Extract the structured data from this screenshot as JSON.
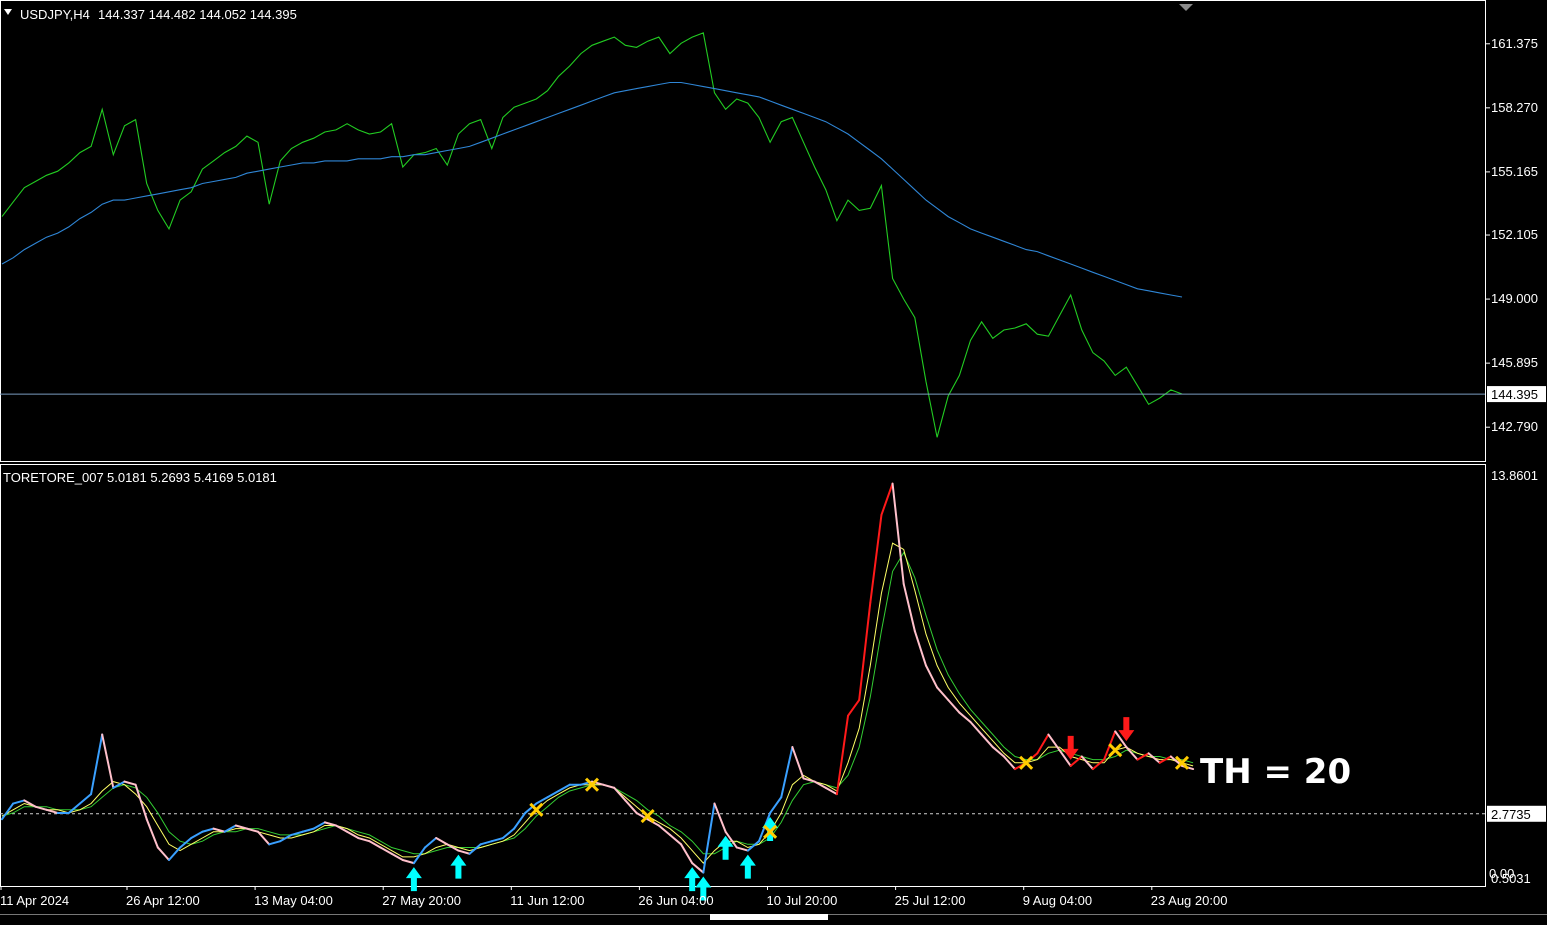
{
  "colors": {
    "background": "#000000",
    "price": "#22cc22",
    "ma": "#2f86d6",
    "rising": "#3aa0ff",
    "falling": "#ff1a1a",
    "neutral": "#ffc0cb",
    "signal_up": "#00ffff",
    "signal_down": "#ff1a1a",
    "cross": "#ffcc00",
    "fast_ma": "#ffff66",
    "slow_ma": "#33cc33",
    "level": "#cfcfcf"
  },
  "chart_data": [
    {
      "type": "line",
      "title": "USDJPY,H4",
      "ohlc": [
        "144.337",
        "144.482",
        "144.052",
        "144.395"
      ],
      "ylim": [
        141.2,
        163.4
      ],
      "y_ticks": [
        "161.375",
        "158.270",
        "155.165",
        "152.105",
        "149.000",
        "145.895",
        "142.790"
      ],
      "current_price": "144.395",
      "series": [
        {
          "name": "",
          "role": "price",
          "color_key": "price",
          "values": [
            153.0,
            153.7,
            154.4,
            154.7,
            155.0,
            155.2,
            155.6,
            156.1,
            156.4,
            158.2,
            156.0,
            157.4,
            157.7,
            154.6,
            153.3,
            152.4,
            153.8,
            154.2,
            155.3,
            155.7,
            156.1,
            156.4,
            156.9,
            156.6,
            153.6,
            155.7,
            156.3,
            156.6,
            156.8,
            157.1,
            157.2,
            157.5,
            157.2,
            157.0,
            157.1,
            157.5,
            155.4,
            156.0,
            156.1,
            156.3,
            155.5,
            157.0,
            157.5,
            157.7,
            156.3,
            157.8,
            158.3,
            158.5,
            158.7,
            159.1,
            159.8,
            160.3,
            160.9,
            161.3,
            161.5,
            161.7,
            161.3,
            161.2,
            161.5,
            161.7,
            160.9,
            161.4,
            161.7,
            161.9,
            159.0,
            158.2,
            158.7,
            158.5,
            157.8,
            156.6,
            157.6,
            157.8,
            156.6,
            155.4,
            154.3,
            152.8,
            153.8,
            153.3,
            153.4,
            154.5,
            150.0,
            149.0,
            148.1,
            145.0,
            142.3,
            144.3,
            145.3,
            147.0,
            147.9,
            147.1,
            147.5,
            147.6,
            147.8,
            147.3,
            147.2,
            148.2,
            149.2,
            147.5,
            146.4,
            146.0,
            145.3,
            145.7,
            144.8,
            143.9,
            144.2,
            144.6,
            144.4
          ]
        },
        {
          "name": "",
          "role": "moving-average",
          "color_key": "ma",
          "values": [
            150.7,
            151.0,
            151.4,
            151.7,
            152.0,
            152.2,
            152.5,
            152.9,
            153.2,
            153.6,
            153.8,
            153.8,
            153.9,
            154.0,
            154.1,
            154.2,
            154.3,
            154.4,
            154.6,
            154.7,
            154.8,
            154.9,
            155.1,
            155.2,
            155.3,
            155.4,
            155.5,
            155.6,
            155.6,
            155.7,
            155.7,
            155.7,
            155.8,
            155.8,
            155.8,
            155.9,
            155.9,
            156.0,
            156.0,
            156.1,
            156.2,
            156.3,
            156.4,
            156.6,
            156.8,
            157.0,
            157.2,
            157.4,
            157.6,
            157.8,
            158.0,
            158.2,
            158.4,
            158.6,
            158.8,
            159.0,
            159.1,
            159.2,
            159.3,
            159.4,
            159.5,
            159.5,
            159.4,
            159.3,
            159.2,
            159.1,
            159.0,
            158.9,
            158.8,
            158.6,
            158.4,
            158.2,
            158.0,
            157.8,
            157.6,
            157.3,
            157.0,
            156.6,
            156.2,
            155.8,
            155.3,
            154.8,
            154.3,
            153.8,
            153.4,
            153.0,
            152.7,
            152.4,
            152.2,
            152.0,
            151.8,
            151.6,
            151.4,
            151.3,
            151.1,
            150.9,
            150.7,
            150.5,
            150.3,
            150.1,
            149.9,
            149.7,
            149.5,
            149.4,
            149.3,
            149.2,
            149.1
          ]
        }
      ]
    },
    {
      "type": "line",
      "title": "TORETORE_007",
      "values_header": [
        "5.0181",
        "5.2693",
        "5.4169",
        "5.0181"
      ],
      "ylim": [
        0.5031,
        13.8601
      ],
      "y_ticks": [
        "13.8601",
        "0.5031"
      ],
      "y_tick_low_overlap": "0.00",
      "level_value": 2.7735,
      "level_label": "2.7735",
      "annotation": "TH = 20",
      "x_ticks": [
        "11 Apr 2024",
        "26 Apr 12:00",
        "13 May 04:00",
        "27 May 20:00",
        "11 Jun 12:00",
        "26 Jun 04:00",
        "10 Jul 20:00",
        "25 Jul 12:00",
        "9 Aug 04:00",
        "23 Aug 20:00"
      ],
      "series": [
        {
          "name": "",
          "role": "main",
          "values": [
            2.6,
            3.1,
            3.2,
            3.0,
            2.9,
            2.8,
            2.8,
            3.1,
            3.4,
            5.3,
            3.6,
            3.8,
            3.7,
            2.6,
            1.7,
            1.3,
            1.7,
            2.0,
            2.2,
            2.3,
            2.2,
            2.4,
            2.3,
            2.2,
            1.8,
            1.9,
            2.1,
            2.2,
            2.3,
            2.5,
            2.4,
            2.2,
            2.0,
            1.9,
            1.7,
            1.5,
            1.3,
            1.2,
            1.7,
            2.0,
            1.8,
            1.6,
            1.5,
            1.8,
            1.9,
            2.0,
            2.3,
            2.8,
            3.1,
            3.3,
            3.5,
            3.7,
            3.7,
            3.8,
            3.7,
            3.6,
            3.2,
            2.8,
            2.6,
            2.4,
            2.1,
            1.8,
            1.2,
            0.9,
            3.1,
            2.2,
            1.7,
            1.6,
            1.9,
            2.8,
            3.3,
            4.9,
            3.9,
            3.8,
            3.6,
            3.4,
            5.9,
            6.4,
            9.5,
            12.3,
            13.3,
            10.1,
            8.6,
            7.5,
            6.8,
            6.4,
            6.0,
            5.7,
            5.3,
            4.9,
            4.6,
            4.2,
            4.4,
            4.7,
            5.3,
            4.8,
            4.3,
            4.6,
            4.2,
            4.5,
            5.4,
            4.9,
            4.5,
            4.7,
            4.4,
            4.6,
            4.3,
            4.2
          ]
        },
        {
          "name": "",
          "role": "fast-ma",
          "values": [
            2.7,
            2.9,
            3.1,
            3.0,
            2.9,
            2.9,
            2.8,
            2.9,
            3.1,
            3.5,
            3.8,
            3.7,
            3.4,
            3.0,
            2.4,
            1.8,
            1.6,
            1.8,
            2.0,
            2.2,
            2.2,
            2.3,
            2.3,
            2.2,
            2.1,
            2.0,
            2.0,
            2.1,
            2.2,
            2.4,
            2.4,
            2.3,
            2.1,
            2.0,
            1.8,
            1.6,
            1.4,
            1.4,
            1.5,
            1.7,
            1.8,
            1.7,
            1.6,
            1.7,
            1.8,
            1.9,
            2.1,
            2.5,
            2.9,
            3.2,
            3.4,
            3.6,
            3.7,
            3.7,
            3.7,
            3.6,
            3.3,
            3.0,
            2.7,
            2.5,
            2.3,
            2.0,
            1.6,
            1.2,
            1.6,
            1.9,
            1.9,
            1.7,
            1.8,
            2.2,
            2.8,
            3.7,
            4.0,
            3.8,
            3.7,
            3.5,
            4.4,
            5.5,
            7.5,
            9.8,
            11.4,
            11.2,
            9.9,
            8.5,
            7.5,
            6.8,
            6.3,
            5.9,
            5.5,
            5.1,
            4.7,
            4.4,
            4.4,
            4.5,
            4.9,
            4.9,
            4.6,
            4.5,
            4.4,
            4.4,
            4.8,
            4.9,
            4.7,
            4.6,
            4.5,
            4.5,
            4.4,
            4.3
          ]
        },
        {
          "name": "",
          "role": "slow-ma",
          "values": [
            2.7,
            2.8,
            3.0,
            3.0,
            3.0,
            2.9,
            2.9,
            2.9,
            3.0,
            3.3,
            3.6,
            3.7,
            3.6,
            3.3,
            2.8,
            2.2,
            1.9,
            1.8,
            1.9,
            2.1,
            2.2,
            2.2,
            2.3,
            2.3,
            2.2,
            2.1,
            2.1,
            2.1,
            2.2,
            2.3,
            2.4,
            2.3,
            2.2,
            2.1,
            1.9,
            1.7,
            1.6,
            1.5,
            1.5,
            1.6,
            1.7,
            1.7,
            1.7,
            1.7,
            1.8,
            1.9,
            2.0,
            2.3,
            2.7,
            3.0,
            3.3,
            3.5,
            3.6,
            3.7,
            3.7,
            3.6,
            3.4,
            3.2,
            2.9,
            2.7,
            2.4,
            2.2,
            1.9,
            1.5,
            1.5,
            1.7,
            1.9,
            1.8,
            1.8,
            2.0,
            2.5,
            3.2,
            3.7,
            3.8,
            3.7,
            3.6,
            4.0,
            4.9,
            6.5,
            8.6,
            10.5,
            11.1,
            10.3,
            9.1,
            8.0,
            7.2,
            6.6,
            6.1,
            5.7,
            5.3,
            4.9,
            4.6,
            4.5,
            4.5,
            4.7,
            4.8,
            4.7,
            4.6,
            4.5,
            4.5,
            4.6,
            4.8,
            4.7,
            4.6,
            4.6,
            4.5,
            4.5,
            4.4
          ]
        }
      ],
      "signals_up_idx": [
        48,
        53,
        79,
        81,
        84,
        86,
        89
      ],
      "signals_down_idx": [
        123,
        130
      ],
      "crosses_idx": [
        62,
        68,
        75,
        88,
        118,
        128,
        136
      ]
    }
  ]
}
